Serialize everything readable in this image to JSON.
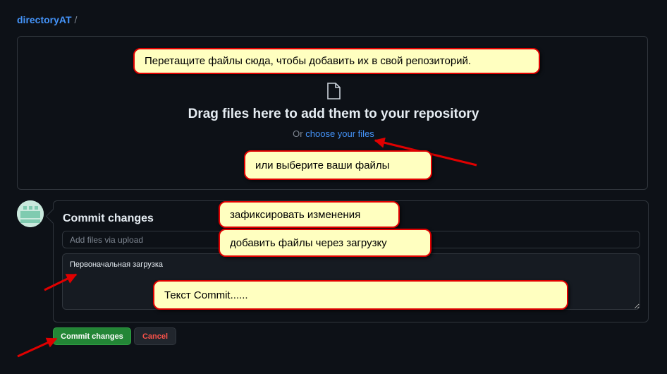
{
  "breadcrumb": {
    "repo": "directoryAT",
    "separator": "/"
  },
  "upload": {
    "icon": "file-icon",
    "title": "Drag files here to add them to your repository",
    "or_text": "Or",
    "choose_link": "choose your files"
  },
  "commit": {
    "title": "Commit changes",
    "summary_placeholder": "Add files via upload",
    "description_value": "Первоначальная загрузка",
    "commit_button": "Commit changes",
    "cancel_button": "Cancel"
  },
  "annotations": {
    "drag_note": "Перетащите файлы сюда, чтобы добавить их в свой репозиторий.",
    "choose_note": "или выберите ваши файлы",
    "commit_note": "зафиксировать изменения",
    "upload_note": "добавить файлы через загрузку",
    "text_note": "Текст Commit......"
  },
  "colors": {
    "background": "#0d1117",
    "link": "#4493f8",
    "commit_green": "#238636",
    "cancel_red": "#f85149",
    "note_fill": "#ffffc0",
    "note_border": "#e00000"
  }
}
